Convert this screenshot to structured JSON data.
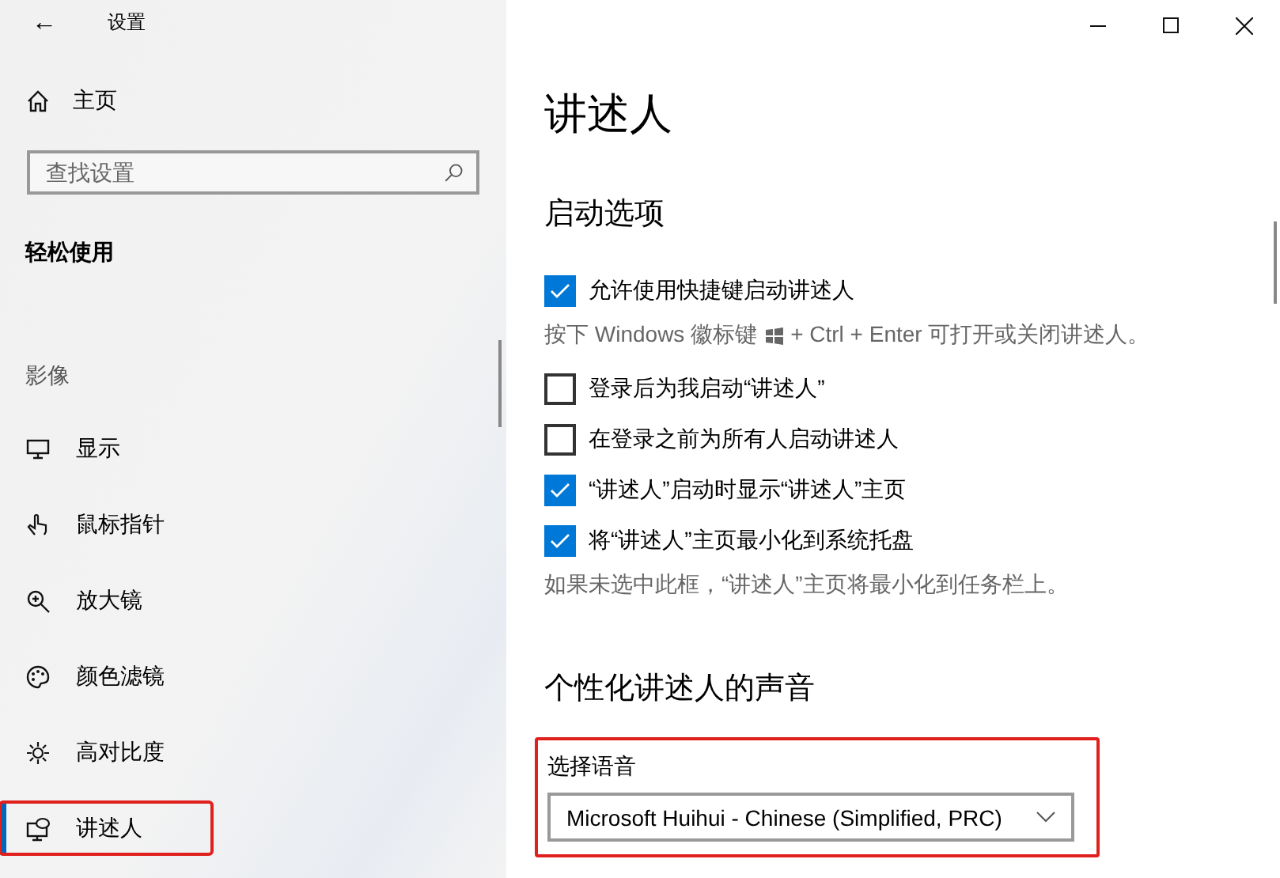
{
  "window": {
    "title": "设置",
    "back": "←"
  },
  "sidebar": {
    "home": "主页",
    "search": {
      "placeholder": "查找设置"
    },
    "category": "轻松使用",
    "group": "影像",
    "items": [
      {
        "label": "显示",
        "selected": false,
        "highlighted": false
      },
      {
        "label": "鼠标指针",
        "selected": false,
        "highlighted": false
      },
      {
        "label": "放大镜",
        "selected": false,
        "highlighted": false
      },
      {
        "label": "颜色滤镜",
        "selected": false,
        "highlighted": false
      },
      {
        "label": "高对比度",
        "selected": false,
        "highlighted": false
      },
      {
        "label": "讲述人",
        "selected": true,
        "highlighted": true
      }
    ]
  },
  "page": {
    "title": "讲述人",
    "startup": {
      "heading": "启动选项",
      "options": [
        {
          "kind": "checkbox",
          "label": "允许使用快捷键启动讲述人",
          "checked": true
        },
        {
          "kind": "hint",
          "before": "按下 Windows 徽标键",
          "after": "+ Ctrl + Enter 可打开或关闭讲述人。"
        },
        {
          "kind": "checkbox",
          "label": "登录后为我启动“讲述人”",
          "checked": false
        },
        {
          "kind": "checkbox",
          "label": "在登录之前为所有人启动讲述人",
          "checked": false
        },
        {
          "kind": "checkbox",
          "label": "“讲述人”启动时显示“讲述人”主页",
          "checked": true
        },
        {
          "kind": "checkbox",
          "label": "将“讲述人”主页最小化到系统托盘",
          "checked": true
        },
        {
          "kind": "hint",
          "before": "如果未选中此框，“讲述人”主页将最小化到任务栏上。"
        }
      ]
    },
    "voice": {
      "heading": "个性化讲述人的声音",
      "highlighted": true,
      "label": "选择语音",
      "value": "Microsoft Huihui - Chinese (Simplified, PRC)"
    }
  }
}
